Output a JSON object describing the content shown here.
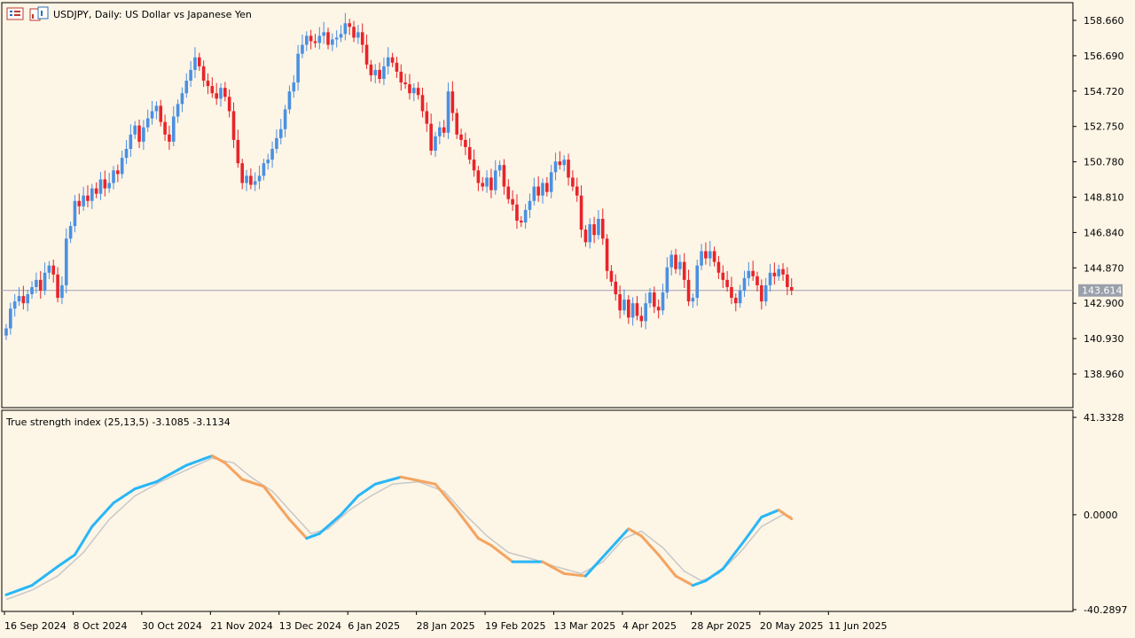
{
  "header": {
    "title": "USDJPY, Daily:  US Dollar vs Japanese Yen",
    "icons": [
      "chart-menu-icon",
      "chart-window-icon"
    ]
  },
  "price_axis": {
    "ticks": [
      "158.660",
      "156.690",
      "154.720",
      "152.750",
      "150.780",
      "148.810",
      "146.840",
      "144.870",
      "142.900",
      "140.930",
      "138.960"
    ],
    "current_price": "143.614",
    "ylim": [
      137.97,
      159.65
    ]
  },
  "indicator": {
    "label": "True strength index (25,13,5) -3.1085 -3.1134",
    "ticks": [
      "41.3328",
      "0.0000",
      "-40.2897"
    ],
    "ylim": [
      -40.2897,
      41.3328
    ]
  },
  "time_axis": {
    "labels": [
      "16 Sep 2024",
      "8 Oct 2024",
      "30 Oct 2024",
      "21 Nov 2024",
      "13 Dec 2024",
      "6 Jan 2025",
      "28 Jan 2025",
      "19 Feb 2025",
      "13 Mar 2025",
      "4 Apr 2025",
      "28 Apr 2025",
      "20 May 2025",
      "11 Jun 2025"
    ]
  },
  "colors": {
    "background": "#fdf5e6",
    "bull": "#4a90e2",
    "bear": "#e8242a",
    "tsi_up": "#29b6f6",
    "tsi_down": "#f4a460",
    "tsi_signal": "#c8c8c8",
    "price_line": "#a0a0b0"
  },
  "chart_data": [
    {
      "type": "candlestick",
      "title": "USDJPY, Daily:  US Dollar vs Japanese Yen",
      "start_date": "2024-09-16",
      "close": [
        141.5,
        142.6,
        143.0,
        143.3,
        142.9,
        143.4,
        143.8,
        144.2,
        143.6,
        144.6,
        145.0,
        144.5,
        143.2,
        143.9,
        146.5,
        147.2,
        148.6,
        148.3,
        148.9,
        148.6,
        149.3,
        149.0,
        149.8,
        149.3,
        149.6,
        150.3,
        150.1,
        151.0,
        151.5,
        152.3,
        152.8,
        151.9,
        152.7,
        153.2,
        153.6,
        153.9,
        153.0,
        152.3,
        151.9,
        153.3,
        154.0,
        154.6,
        155.3,
        155.9,
        156.6,
        156.1,
        155.3,
        155.0,
        154.6,
        154.3,
        154.9,
        154.4,
        153.6,
        152.0,
        150.7,
        149.6,
        150.0,
        149.5,
        149.7,
        150.0,
        150.7,
        150.9,
        151.5,
        152.1,
        152.6,
        153.7,
        154.7,
        155.2,
        156.8,
        157.3,
        157.8,
        157.5,
        157.4,
        157.8,
        158.0,
        157.3,
        157.6,
        157.7,
        157.9,
        158.5,
        158.3,
        157.7,
        158.0,
        157.3,
        156.2,
        155.6,
        155.9,
        155.4,
        156.1,
        156.6,
        156.3,
        155.8,
        155.2,
        155.1,
        154.6,
        154.9,
        154.5,
        153.6,
        152.9,
        151.4,
        152.2,
        152.7,
        152.4,
        154.7,
        153.5,
        152.3,
        152.0,
        151.6,
        150.9,
        150.3,
        149.6,
        149.4,
        149.9,
        149.2,
        150.3,
        150.6,
        149.4,
        148.7,
        148.4,
        147.5,
        147.4,
        148.1,
        148.6,
        149.4,
        148.9,
        149.6,
        149.1,
        150.2,
        150.8,
        150.6,
        150.9,
        149.9,
        149.4,
        148.9,
        147.0,
        146.3,
        147.3,
        146.7,
        147.6,
        146.5,
        144.7,
        144.1,
        143.4,
        142.5,
        143.1,
        142.1,
        142.9,
        142.2,
        141.9,
        142.9,
        143.5,
        142.7,
        142.5,
        143.5,
        144.9,
        145.6,
        144.8,
        145.2,
        144.2,
        143.0,
        143.2,
        145.0,
        145.8,
        145.4,
        145.8,
        145.2,
        144.6,
        144.2,
        143.8,
        143.2,
        142.9,
        143.6,
        144.3,
        144.7,
        144.4,
        143.9,
        143.0,
        143.9,
        144.6,
        144.4,
        144.8,
        144.5,
        143.8,
        143.6
      ],
      "y_range": [
        137.97,
        159.65
      ],
      "y_ticks": [
        158.66,
        156.69,
        154.72,
        152.75,
        150.78,
        148.81,
        146.84,
        144.87,
        142.9,
        140.93,
        138.96
      ],
      "current_price": 143.614
    },
    {
      "type": "line",
      "title": "True strength index (25,13,5)",
      "series": [
        {
          "name": "TSI",
          "last": -3.1085
        },
        {
          "name": "Signal",
          "last": -3.1134
        }
      ],
      "y_range": [
        -40.2897,
        41.3328
      ],
      "y_ticks": [
        41.3328,
        0.0,
        -40.2897
      ],
      "tsi_keypoints": [
        [
          0,
          -34
        ],
        [
          6,
          -30
        ],
        [
          12,
          -22
        ],
        [
          16,
          -17
        ],
        [
          20,
          -5
        ],
        [
          25,
          5
        ],
        [
          30,
          11
        ],
        [
          35,
          14
        ],
        [
          42,
          21
        ],
        [
          48,
          25
        ],
        [
          51,
          22
        ],
        [
          55,
          15
        ],
        [
          60,
          12
        ],
        [
          66,
          -2
        ],
        [
          70,
          -10
        ],
        [
          73,
          -8
        ],
        [
          78,
          0
        ],
        [
          82,
          8
        ],
        [
          86,
          13
        ],
        [
          92,
          16
        ],
        [
          100,
          13
        ],
        [
          105,
          2
        ],
        [
          110,
          -10
        ],
        [
          113,
          -13
        ],
        [
          118,
          -20
        ],
        [
          125,
          -20
        ],
        [
          130,
          -25
        ],
        [
          135,
          -26
        ],
        [
          140,
          -16
        ],
        [
          145,
          -6
        ],
        [
          148,
          -9
        ],
        [
          152,
          -17
        ],
        [
          156,
          -26
        ],
        [
          160,
          -30
        ],
        [
          163,
          -28
        ],
        [
          167,
          -23
        ],
        [
          172,
          -11
        ],
        [
          176,
          -1
        ],
        [
          180,
          2
        ],
        [
          184,
          -3
        ],
        [
          190,
          -4
        ],
        [
          194,
          -5
        ],
        [
          198,
          -2
        ],
        [
          201,
          -3
        ]
      ],
      "signal_keypoints": [
        [
          0,
          -36
        ],
        [
          6,
          -32
        ],
        [
          12,
          -26
        ],
        [
          18,
          -16
        ],
        [
          24,
          -2
        ],
        [
          30,
          8
        ],
        [
          36,
          14
        ],
        [
          42,
          19
        ],
        [
          48,
          24
        ],
        [
          53,
          22
        ],
        [
          57,
          16
        ],
        [
          62,
          10
        ],
        [
          67,
          0
        ],
        [
          71,
          -8
        ],
        [
          75,
          -6
        ],
        [
          80,
          2
        ],
        [
          85,
          8
        ],
        [
          90,
          13
        ],
        [
          96,
          14
        ],
        [
          102,
          10
        ],
        [
          107,
          0
        ],
        [
          112,
          -9
        ],
        [
          117,
          -16
        ],
        [
          123,
          -19
        ],
        [
          128,
          -22
        ],
        [
          134,
          -25
        ],
        [
          139,
          -20
        ],
        [
          144,
          -10
        ],
        [
          148,
          -7
        ],
        [
          153,
          -14
        ],
        [
          158,
          -24
        ],
        [
          162,
          -28
        ],
        [
          166,
          -25
        ],
        [
          171,
          -16
        ],
        [
          176,
          -5
        ],
        [
          181,
          0
        ],
        [
          186,
          -2
        ],
        [
          191,
          -4
        ],
        [
          195,
          -4
        ],
        [
          199,
          -3
        ],
        [
          201,
          -3
        ]
      ]
    }
  ]
}
